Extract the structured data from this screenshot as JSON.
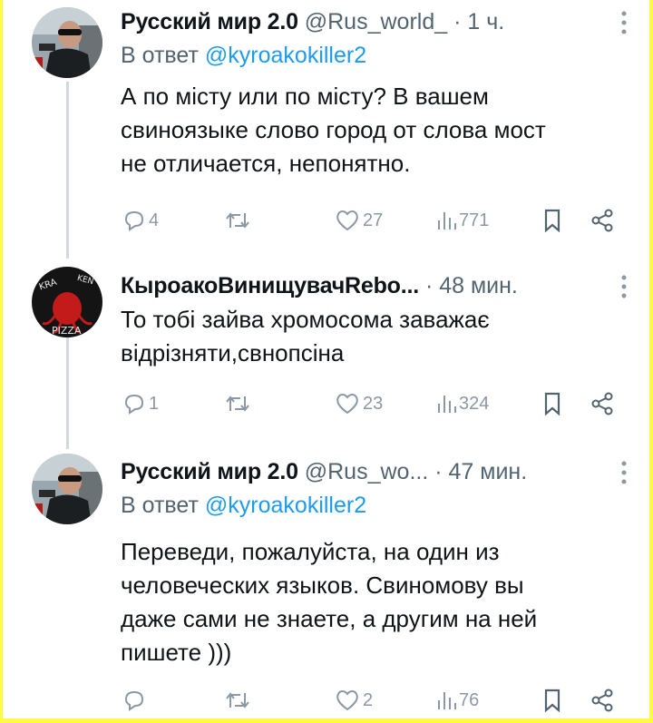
{
  "colors": {
    "background_accent": "#fefb42",
    "text_primary": "#0f1419",
    "text_secondary": "#536471",
    "link": "#1d9bf0",
    "icon": "#8b98a5"
  },
  "tweets": [
    {
      "name": "Русский мир 2.0",
      "handle": "@Rus_world_",
      "dot": "·",
      "time": "1 ч.",
      "reply_prefix": "В ответ",
      "reply_mention": "@kyroakokiller2",
      "text": "А по місту или по місту? В вашем\nсвиноязыке слово город от слова мост\nне отличается, непонятно.",
      "stats": {
        "replies": "4",
        "retweets": "",
        "likes": "27",
        "views": "771"
      },
      "icons": [
        "reply-icon",
        "retweet-icon",
        "like-icon",
        "views-icon",
        "bookmark-icon",
        "share-icon",
        "more-icon"
      ]
    },
    {
      "name": "КыроакоВинищувачRebo...",
      "handle": "",
      "dot": "·",
      "time": "48 мин.",
      "reply_prefix": "",
      "reply_mention": "",
      "text": "То тобі зайва хромосома заважає\nвідрізняти,свнопсіна",
      "stats": {
        "replies": "1",
        "retweets": "",
        "likes": "23",
        "views": "324"
      },
      "avatar_text": "KRAKEN PIZZA"
    },
    {
      "name": "Русский мир 2.0",
      "handle": "@Rus_wo...",
      "dot": "·",
      "time": "47 мин.",
      "reply_prefix": "В ответ",
      "reply_mention": "@kyroakokiller2",
      "text": "Переведи, пожалуйста, на один из\nчеловеческих языков. Свиномову вы\nдаже сами не знаете, а другим на ней\nпишете )))",
      "stats": {
        "replies": "",
        "retweets": "",
        "likes": "2",
        "views": "76"
      }
    }
  ]
}
